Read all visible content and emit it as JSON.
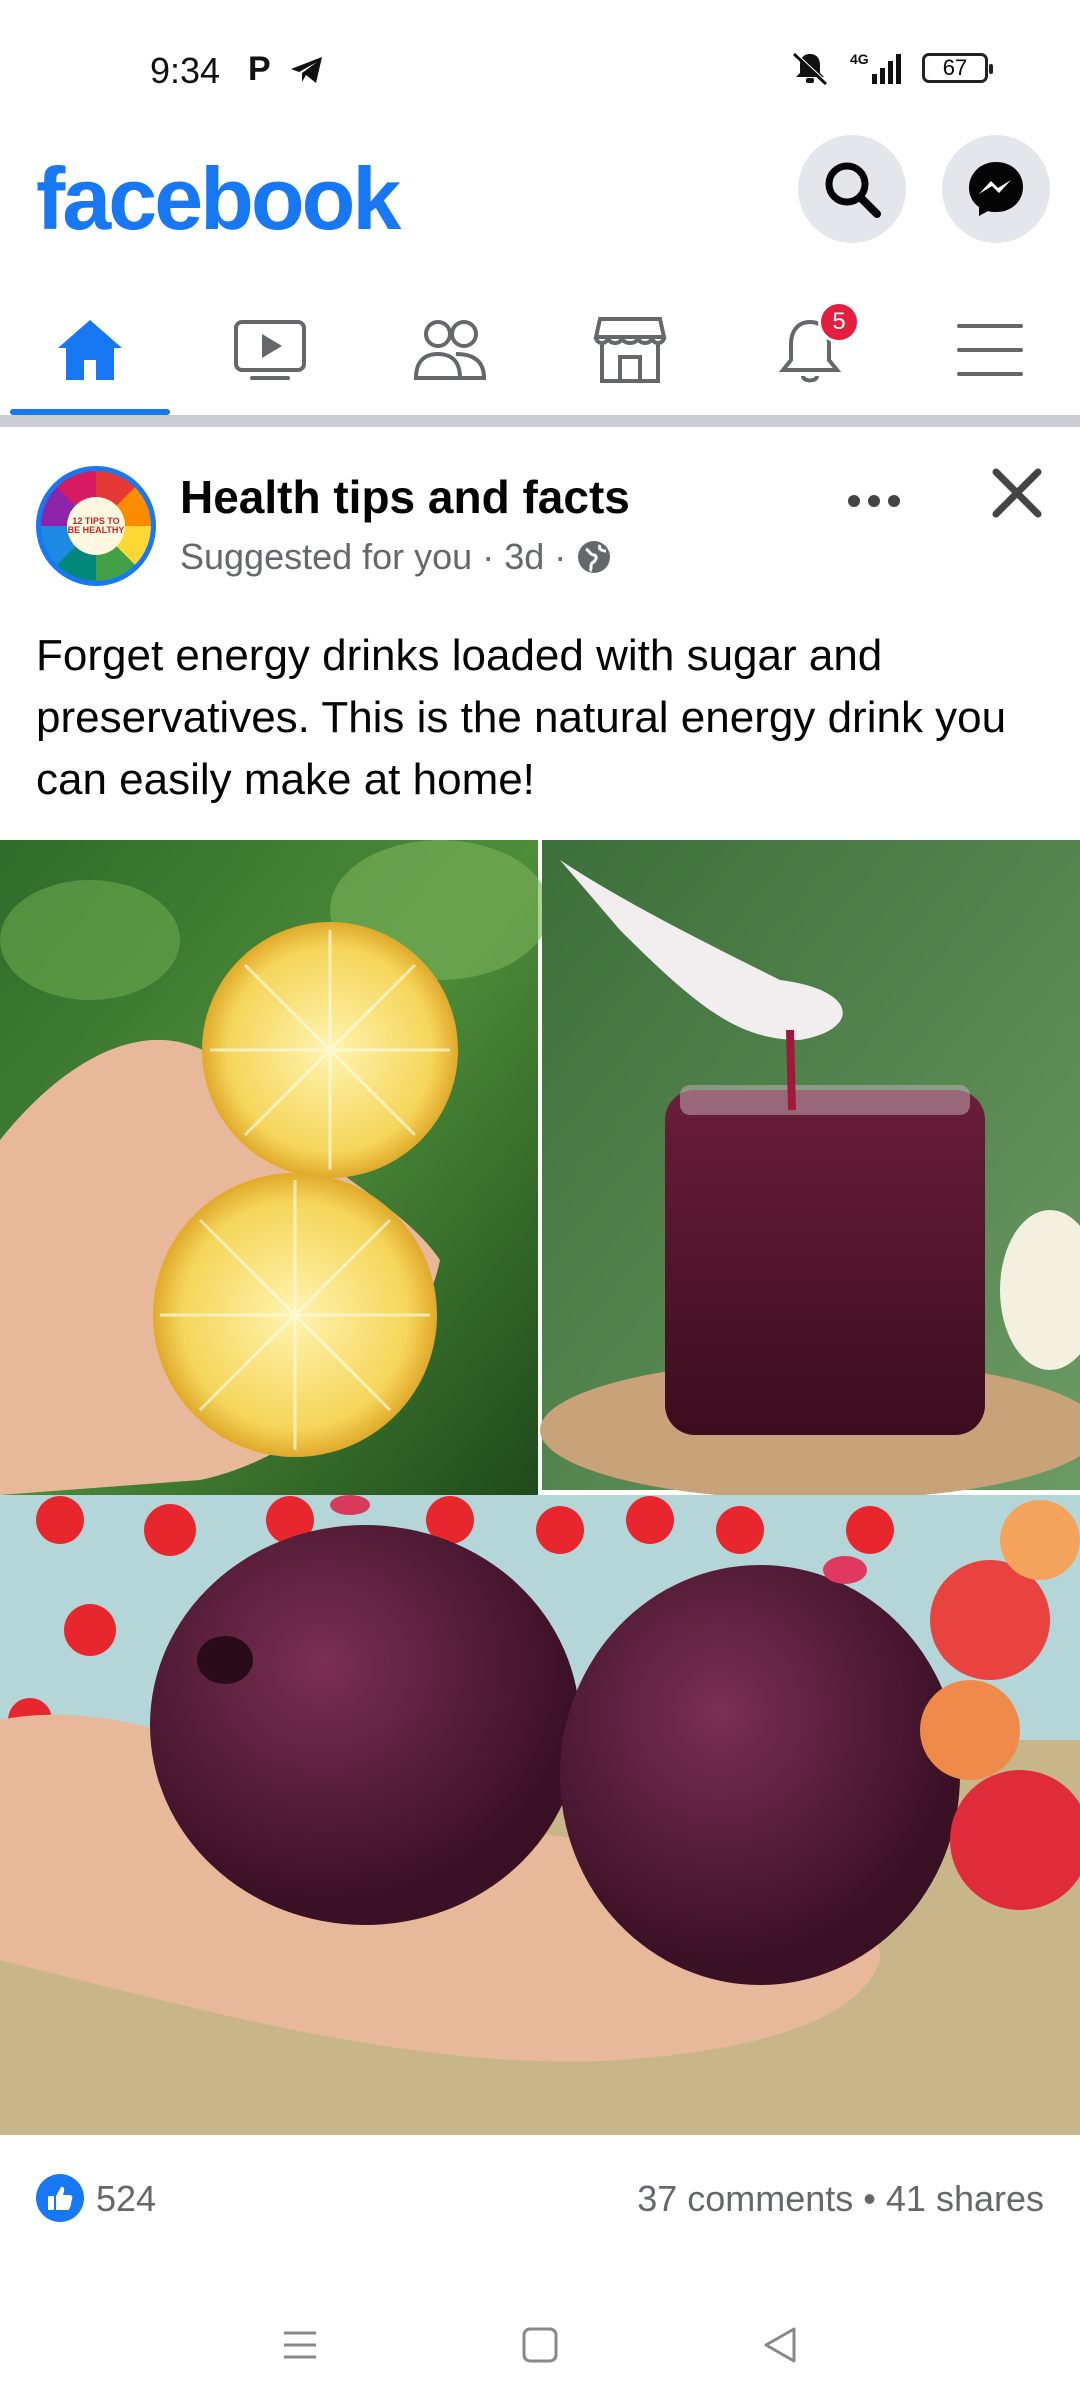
{
  "status_bar": {
    "time": "9:34",
    "left_icons": [
      "p-icon",
      "telegram-icon"
    ],
    "network": "4G",
    "battery": "67"
  },
  "header": {
    "logo": "facebook",
    "brand_color": "#1877f2"
  },
  "nav_tabs": [
    {
      "name": "home-icon",
      "active": true
    },
    {
      "name": "video-icon",
      "active": false
    },
    {
      "name": "friends-icon",
      "active": false
    },
    {
      "name": "marketplace-icon",
      "active": false
    },
    {
      "name": "notifications-icon",
      "active": false,
      "badge": "5"
    },
    {
      "name": "menu-icon",
      "active": false
    }
  ],
  "post": {
    "author": "Health tips and facts",
    "avatar_text": "12 TIPS TO BE HEALTHY",
    "meta": "Suggested for you · 3d ·",
    "text": "Forget energy drinks loaded with sugar and preservatives. This is the natural energy drink you can easily make at home!",
    "images": [
      "lemon halves in hand",
      "spoon dripping beet juice into jar",
      "two beetroots in hand"
    ],
    "likes": "524",
    "stats": "37 comments • 41 shares"
  }
}
